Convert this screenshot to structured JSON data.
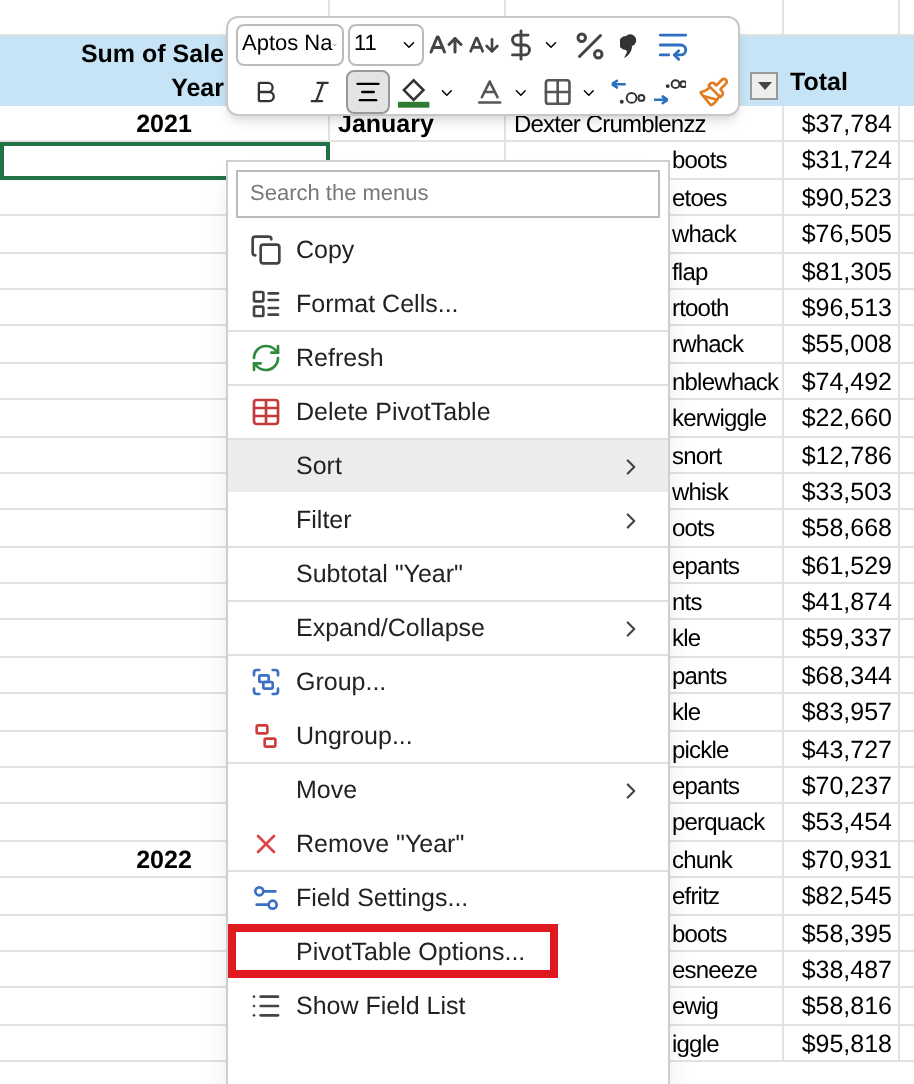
{
  "sheet": {
    "header": {
      "value_label": "Sum of Sale",
      "row_label": "Year",
      "total_label": "Total"
    },
    "rows": [
      {
        "year": "2021",
        "month": "January",
        "name": "Dexter Crumblenzz",
        "total": "$37,784",
        "active": false
      },
      {
        "name": "boots",
        "total": "$31,724",
        "active": true
      },
      {
        "name": "etoes",
        "total": "$90,523",
        "active": false
      },
      {
        "name": "whack",
        "total": "$76,505",
        "active": false
      },
      {
        "name": "flap",
        "total": "$81,305",
        "active": false
      },
      {
        "name": "rtooth",
        "total": "$96,513",
        "active": false
      },
      {
        "name": "rwhack",
        "total": "$55,008",
        "active": false
      },
      {
        "name": "nblewhack",
        "total": "$74,492",
        "active": false
      },
      {
        "name": "kerwiggle",
        "total": "$22,660",
        "active": false
      },
      {
        "name": "snort",
        "total": "$12,786",
        "active": false
      },
      {
        "name": "whisk",
        "total": "$33,503",
        "active": false
      },
      {
        "name": "oots",
        "total": "$58,668",
        "active": false
      },
      {
        "name": "epants",
        "total": "$61,529",
        "active": false
      },
      {
        "name": "nts",
        "total": "$41,874",
        "active": false
      },
      {
        "name": "kle",
        "total": "$59,337",
        "active": false
      },
      {
        "name": "pants",
        "total": "$68,344",
        "active": false
      },
      {
        "name": "kle",
        "total": "$83,957",
        "active": false
      },
      {
        "name": "pickle",
        "total": "$43,727",
        "active": false
      },
      {
        "name": "epants",
        "total": "$70,237",
        "active": false
      },
      {
        "name": "perquack",
        "total": "$53,454",
        "active": false
      },
      {
        "year": "2022",
        "name": "chunk",
        "total": "$70,931",
        "active": false
      },
      {
        "name": "efritz",
        "total": "$82,545",
        "active": false
      },
      {
        "name": "boots",
        "total": "$58,395",
        "active": false
      },
      {
        "name": "esneeze",
        "total": "$38,487",
        "active": false
      },
      {
        "name": "ewig",
        "total": "$58,816",
        "active": false
      },
      {
        "name": "iggle",
        "total": "$95,818",
        "active": false
      }
    ]
  },
  "mini_toolbar": {
    "font": "Aptos Na",
    "size": "11",
    "align_center_pressed": true
  },
  "context_menu": {
    "search": {
      "placeholder": "Search the menus"
    },
    "items": [
      {
        "label": "Copy",
        "kind": "copy",
        "separator_before": false,
        "submenu": false,
        "selected": false,
        "outlined": false
      },
      {
        "label": "Format Cells...",
        "kind": "format",
        "separator_before": false,
        "submenu": false,
        "selected": false,
        "outlined": false
      },
      {
        "label": "Refresh",
        "kind": "refresh",
        "separator_before": true,
        "submenu": false,
        "selected": false,
        "outlined": false
      },
      {
        "label": "Delete PivotTable",
        "kind": "delete",
        "separator_before": true,
        "submenu": false,
        "selected": false,
        "outlined": false
      },
      {
        "label": "Sort",
        "kind": "none",
        "separator_before": true,
        "submenu": true,
        "selected": true,
        "outlined": false
      },
      {
        "label": "Filter",
        "kind": "none",
        "separator_before": false,
        "submenu": true,
        "selected": false,
        "outlined": false
      },
      {
        "label": "Subtotal \"Year\"",
        "kind": "none",
        "separator_before": true,
        "submenu": false,
        "selected": false,
        "outlined": false
      },
      {
        "label": "Expand/Collapse",
        "kind": "none",
        "separator_before": true,
        "submenu": true,
        "selected": false,
        "outlined": false
      },
      {
        "label": "Group...",
        "kind": "group",
        "separator_before": true,
        "submenu": false,
        "selected": false,
        "outlined": false
      },
      {
        "label": "Ungroup...",
        "kind": "ungroup",
        "separator_before": false,
        "submenu": false,
        "selected": false,
        "outlined": false
      },
      {
        "label": "Move",
        "kind": "none",
        "separator_before": true,
        "submenu": true,
        "selected": false,
        "outlined": false
      },
      {
        "label": "Remove \"Year\"",
        "kind": "remove",
        "separator_before": false,
        "submenu": false,
        "selected": false,
        "outlined": false
      },
      {
        "label": "Field Settings...",
        "kind": "settings",
        "separator_before": true,
        "submenu": false,
        "selected": false,
        "outlined": false
      },
      {
        "label": "PivotTable Options...",
        "kind": "none",
        "separator_before": false,
        "submenu": false,
        "selected": false,
        "outlined": true
      },
      {
        "label": "Show Field List",
        "kind": "fieldlist",
        "separator_before": false,
        "submenu": false,
        "selected": false,
        "outlined": false
      }
    ]
  }
}
